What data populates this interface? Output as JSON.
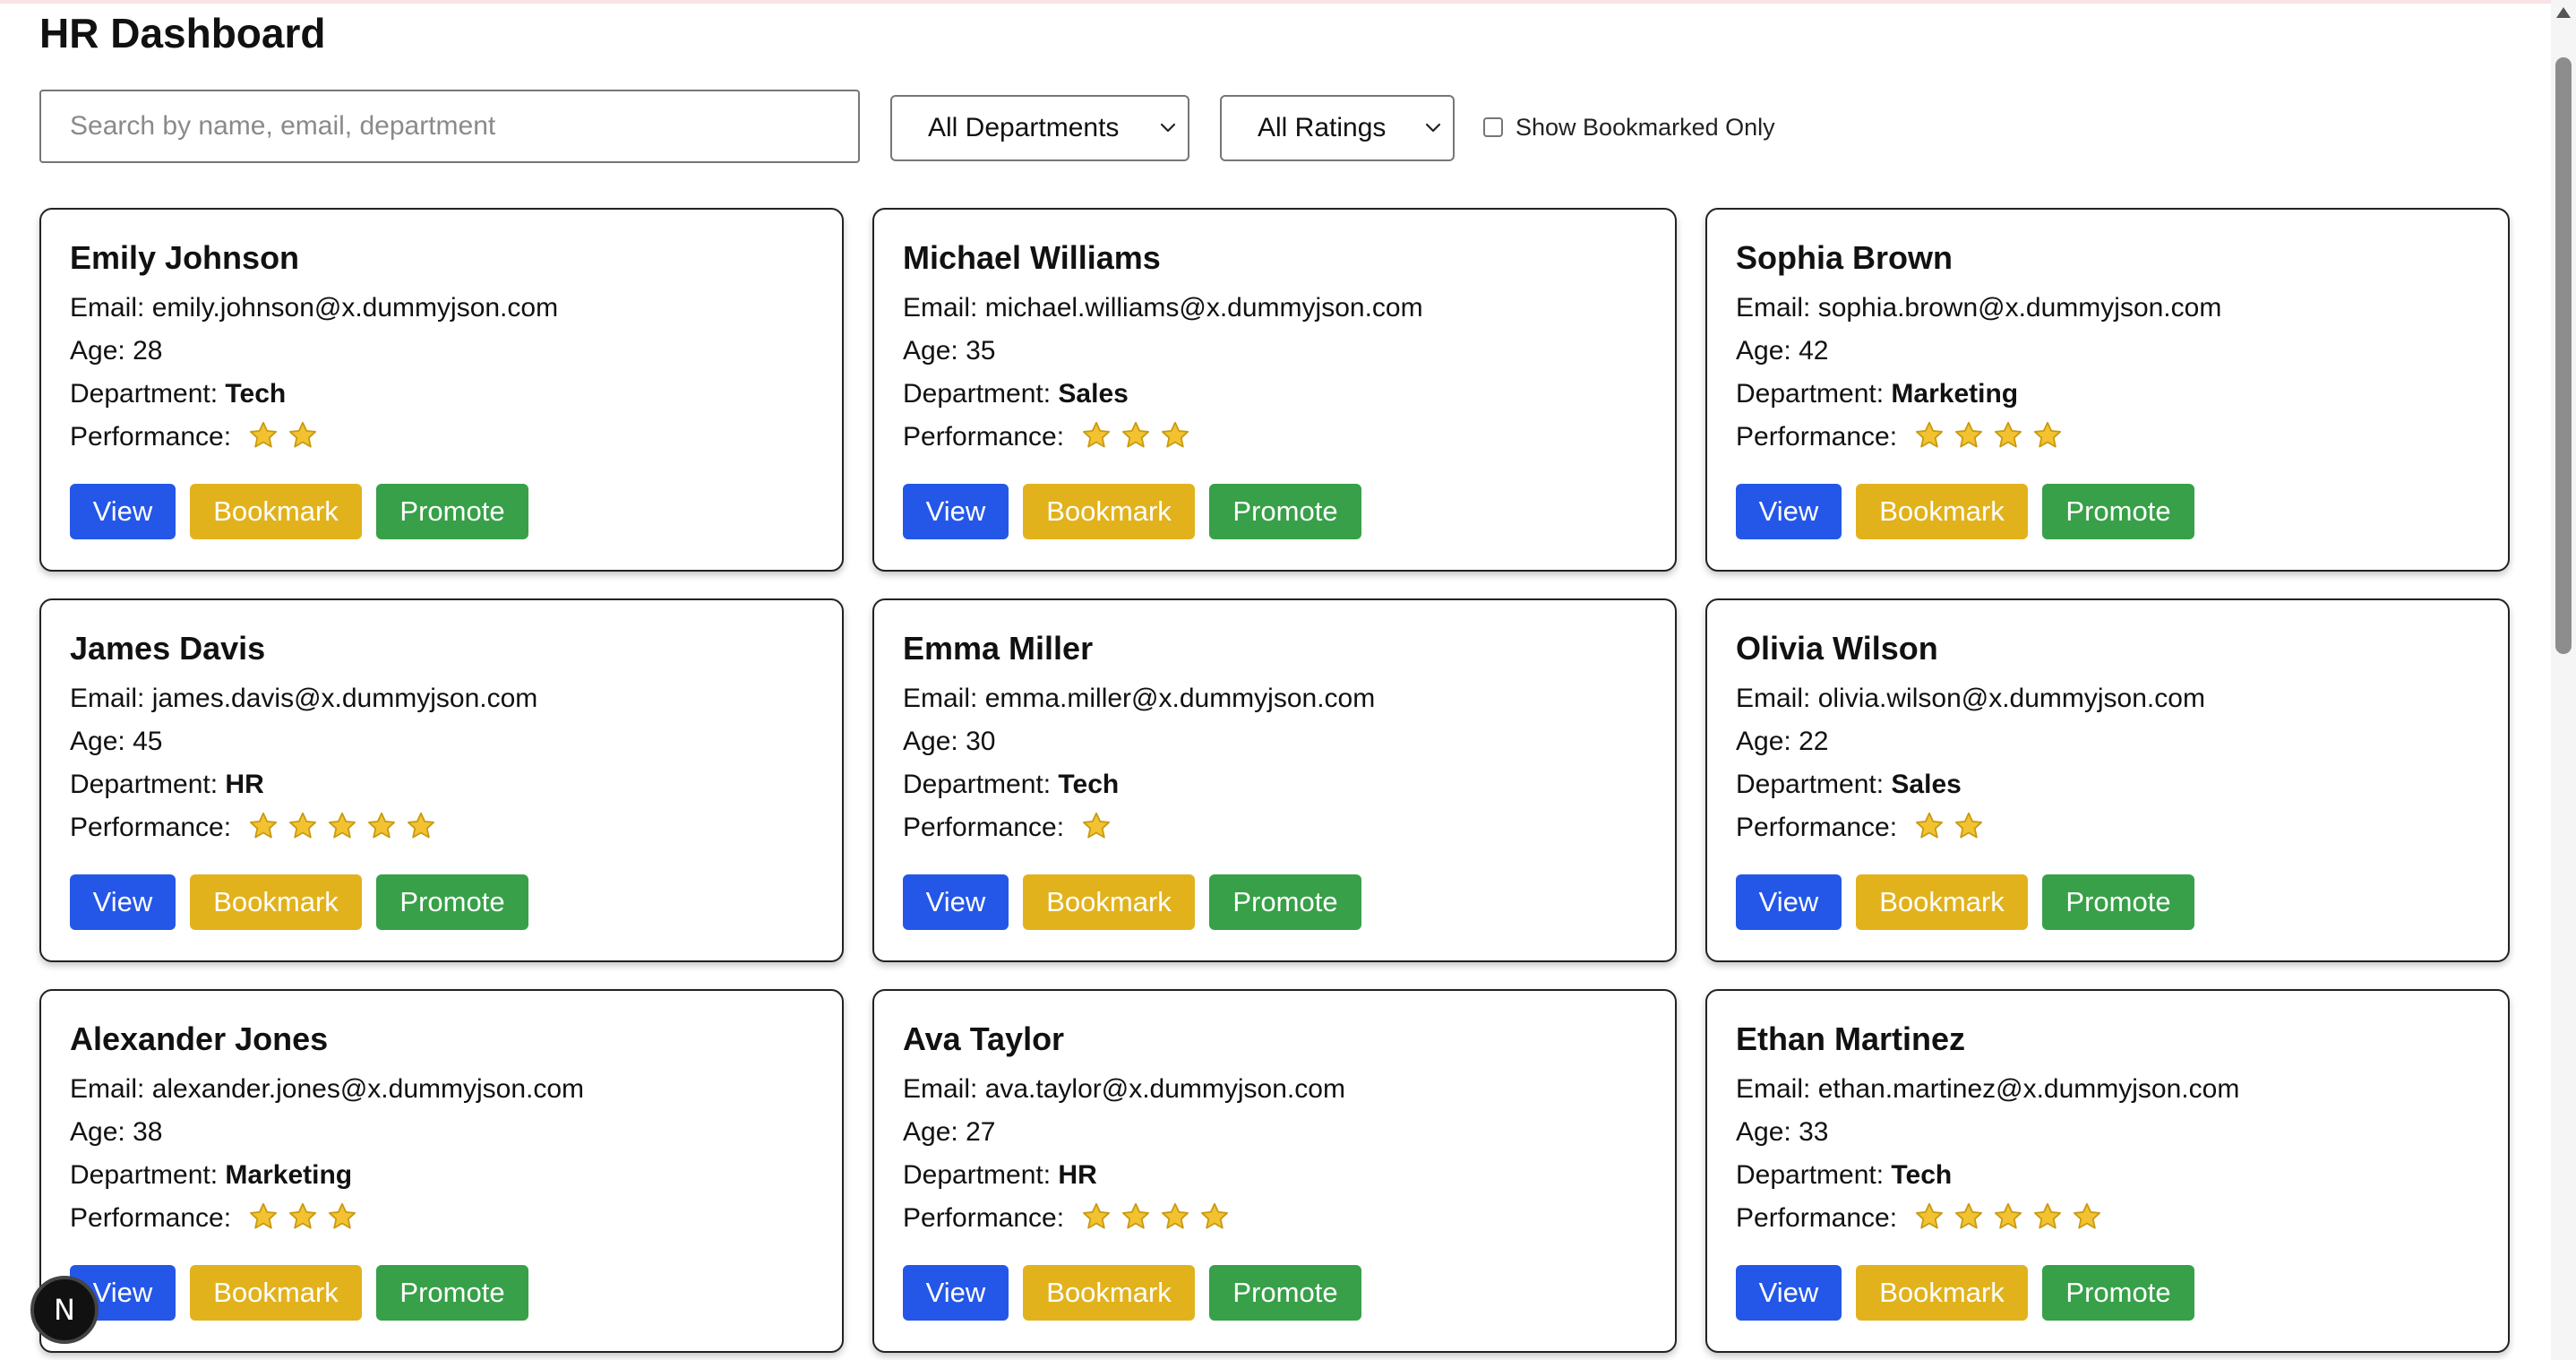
{
  "page": {
    "title": "HR Dashboard"
  },
  "filters": {
    "search_placeholder": "Search by name, email, department",
    "search_value": "",
    "department_selected": "All Departments",
    "rating_selected": "All Ratings",
    "bookmarked_label": "Show Bookmarked Only",
    "bookmarked_checked": false
  },
  "labels": {
    "email": "Email: ",
    "age": "Age: ",
    "department": "Department: ",
    "performance": "Performance: ",
    "view": "View",
    "bookmark": "Bookmark",
    "promote": "Promote"
  },
  "colors": {
    "view": "#2457e8",
    "bookmark": "#e2b21c",
    "promote": "#37a048",
    "star_fill": "#f2c230",
    "star_stroke": "#c99a10"
  },
  "icons": {
    "star": "star-icon",
    "chevron": "chevron-down-icon",
    "badge": "N"
  },
  "employees": [
    {
      "name": "Emily Johnson",
      "email": "emily.johnson@x.dummyjson.com",
      "age": "28",
      "department": "Tech",
      "rating": 2
    },
    {
      "name": "Michael Williams",
      "email": "michael.williams@x.dummyjson.com",
      "age": "35",
      "department": "Sales",
      "rating": 3
    },
    {
      "name": "Sophia Brown",
      "email": "sophia.brown@x.dummyjson.com",
      "age": "42",
      "department": "Marketing",
      "rating": 4
    },
    {
      "name": "James Davis",
      "email": "james.davis@x.dummyjson.com",
      "age": "45",
      "department": "HR",
      "rating": 5
    },
    {
      "name": "Emma Miller",
      "email": "emma.miller@x.dummyjson.com",
      "age": "30",
      "department": "Tech",
      "rating": 1
    },
    {
      "name": "Olivia Wilson",
      "email": "olivia.wilson@x.dummyjson.com",
      "age": "22",
      "department": "Sales",
      "rating": 2
    },
    {
      "name": "Alexander Jones",
      "email": "alexander.jones@x.dummyjson.com",
      "age": "38",
      "department": "Marketing",
      "rating": 3
    },
    {
      "name": "Ava Taylor",
      "email": "ava.taylor@x.dummyjson.com",
      "age": "27",
      "department": "HR",
      "rating": 4
    },
    {
      "name": "Ethan Martinez",
      "email": "ethan.martinez@x.dummyjson.com",
      "age": "33",
      "department": "Tech",
      "rating": 5
    }
  ]
}
